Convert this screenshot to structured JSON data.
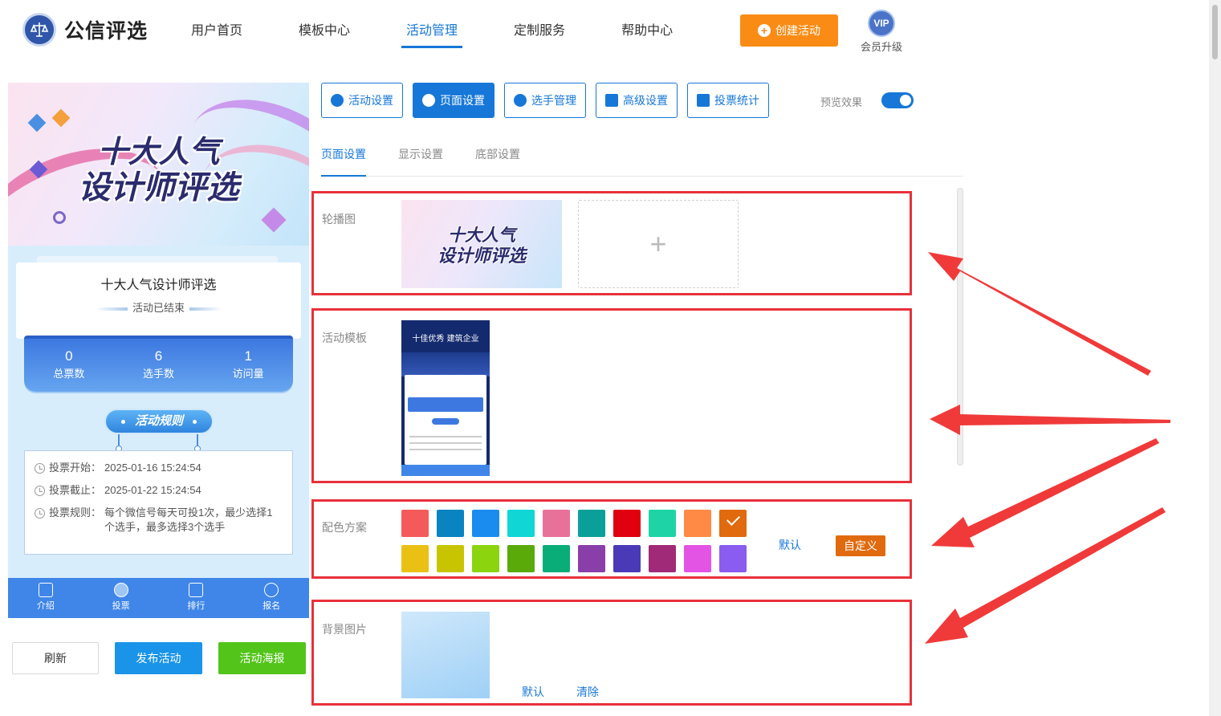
{
  "app": {
    "name": "公信评选"
  },
  "nav": [
    {
      "label": "用户首页",
      "active": false
    },
    {
      "label": "模板中心",
      "active": false
    },
    {
      "label": "活动管理",
      "active": true
    },
    {
      "label": "定制服务",
      "active": false
    },
    {
      "label": "帮助中心",
      "active": false
    }
  ],
  "header": {
    "create_label": "创建活动",
    "vip_badge": "VIP",
    "vip_label": "会员升级"
  },
  "preview": {
    "banner_line1": "十大人气",
    "banner_line2": "设计师评选",
    "title": "十大人气设计师评选",
    "status": "活动已结束",
    "stats": [
      {
        "value": "0",
        "label": "总票数"
      },
      {
        "value": "6",
        "label": "选手数"
      },
      {
        "value": "1",
        "label": "访问量"
      }
    ],
    "rules_title": "活动规则",
    "rules": [
      {
        "key": "投票开始：",
        "value": "2025-01-16 15:24:54"
      },
      {
        "key": "投票截止：",
        "value": "2025-01-22 15:24:54"
      },
      {
        "key": "投票规则：",
        "value": "每个微信号每天可投1次，最少选择1个选手，最多选择3个选手"
      }
    ],
    "tabs": [
      {
        "label": "介绍",
        "icon": "document-icon"
      },
      {
        "label": "投票",
        "icon": "vote-icon"
      },
      {
        "label": "排行",
        "icon": "chart-icon"
      },
      {
        "label": "报名",
        "icon": "user-icon"
      }
    ]
  },
  "actions": {
    "refresh": "刷新",
    "publish": "发布活动",
    "poster": "活动海报"
  },
  "toolbar": {
    "buttons": [
      {
        "label": "活动设置",
        "icon": "star-icon",
        "active": false
      },
      {
        "label": "页面设置",
        "icon": "gear-icon",
        "active": true
      },
      {
        "label": "选手管理",
        "icon": "users-icon",
        "active": false
      },
      {
        "label": "高级设置",
        "icon": "settings-icon",
        "active": false
      },
      {
        "label": "投票统计",
        "icon": "bar-chart-icon",
        "active": false
      }
    ],
    "preview_label": "预览效果",
    "preview_on": true
  },
  "subtabs": [
    {
      "label": "页面设置",
      "active": true
    },
    {
      "label": "显示设置",
      "active": false
    },
    {
      "label": "底部设置",
      "active": false
    }
  ],
  "sections": {
    "carousel_label": "轮播图",
    "carousel_thumb_line1": "十大人气",
    "carousel_thumb_line2": "设计师评选",
    "carousel_add": "+",
    "template_label": "活动模板",
    "template_thumb_title": "十佳优秀 建筑企业",
    "colors_label": "配色方案",
    "colors_row1": [
      "#f55a5a",
      "#0a84c0",
      "#1a8cf0",
      "#10d6d6",
      "#e8719a",
      "#0aa099",
      "#e0000f",
      "#1ed4a6",
      "#ff8a45",
      "#e06a0d"
    ],
    "colors_row2": [
      "#ebc014",
      "#c8c400",
      "#8bd40e",
      "#5aaa0a",
      "#0aad78",
      "#8a3eaa",
      "#4a3ab8",
      "#a02a78",
      "#e454e4",
      "#8a5cf0"
    ],
    "selected_color": "#e06a0d",
    "colors_default": "默认",
    "colors_custom": "自定义",
    "bg_label": "背景图片",
    "bg_default": "默认",
    "bg_clear": "清除"
  }
}
